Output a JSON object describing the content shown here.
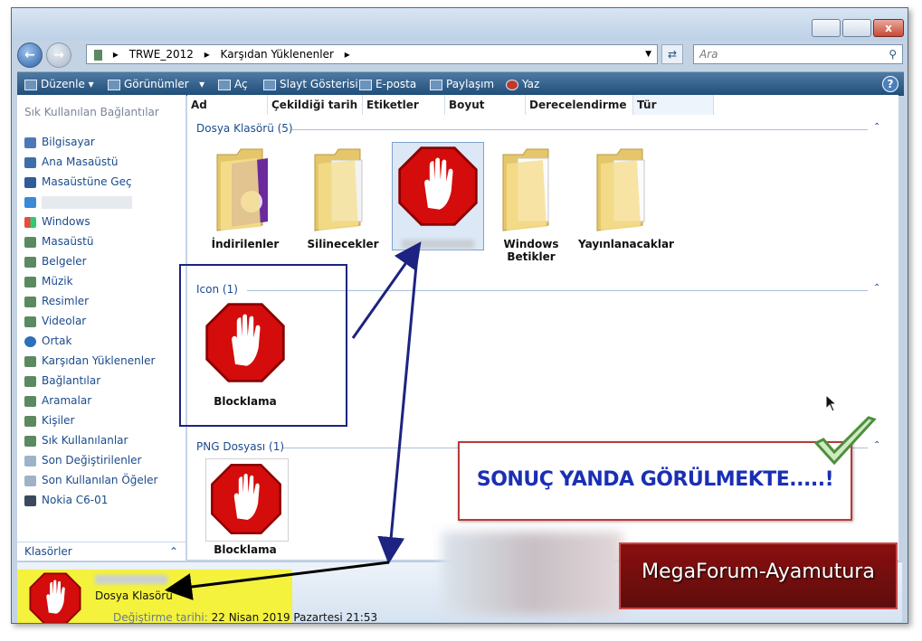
{
  "address": {
    "crumbs": [
      "TRWE_2012",
      "Karşıdan Yüklenenler"
    ]
  },
  "search": {
    "placeholder": "Ara"
  },
  "toolbar": {
    "items": [
      "Düzenle",
      "Görünümler",
      "Aç",
      "Slayt Gösterisi",
      "E-posta",
      "Paylaşım",
      "Yaz"
    ]
  },
  "sidebar": {
    "header": "Sık Kullanılan Bağlantılar",
    "items": [
      "Bilgisayar",
      "Ana Masaüstü",
      "Masaüstüne Geç",
      "",
      "Windows",
      "Masaüstü",
      "Belgeler",
      "Müzik",
      "Resimler",
      "Videolar",
      "Ortak",
      "Karşıdan Yüklenenler",
      "Bağlantılar",
      "Aramalar",
      "Kişiler",
      "Sık Kullanılanlar",
      "Son Değiştirilenler",
      "Son Kullanılan Öğeler",
      "Nokia C6-01"
    ],
    "folders_label": "Klasörler"
  },
  "columns": [
    "Ad",
    "Çekildiği tarih",
    "Etiketler",
    "Boyut",
    "Derecelendirme",
    "Tür"
  ],
  "groups": [
    {
      "label": "Dosya Klasörü (5)",
      "items": [
        "İndirilenler",
        "Silinecekler",
        "",
        "Windows Betikler",
        "Yayınlanacaklar"
      ]
    },
    {
      "label": "Icon (1)",
      "items": [
        "Blocklama"
      ]
    },
    {
      "label": "PNG Dosyası (1)",
      "items": [
        "Blocklama"
      ]
    }
  ],
  "status": {
    "type": "Dosya Klasörü",
    "modified_label": "Değiştirme tarihi:",
    "modified_value": "22 Nisan 2019 Pazartesi 21:53"
  },
  "overlay": {
    "banner": "SONUÇ YANDA GÖRÜLMEKTE.....!",
    "logo": "MegaForum-Ayamutura"
  },
  "colors": {
    "toolbar": "#2a5a87",
    "banner_text": "#1a2fb5",
    "banner_border": "#b83a3a",
    "highlight": "#f4f23c",
    "annotation": "#1d2380"
  }
}
